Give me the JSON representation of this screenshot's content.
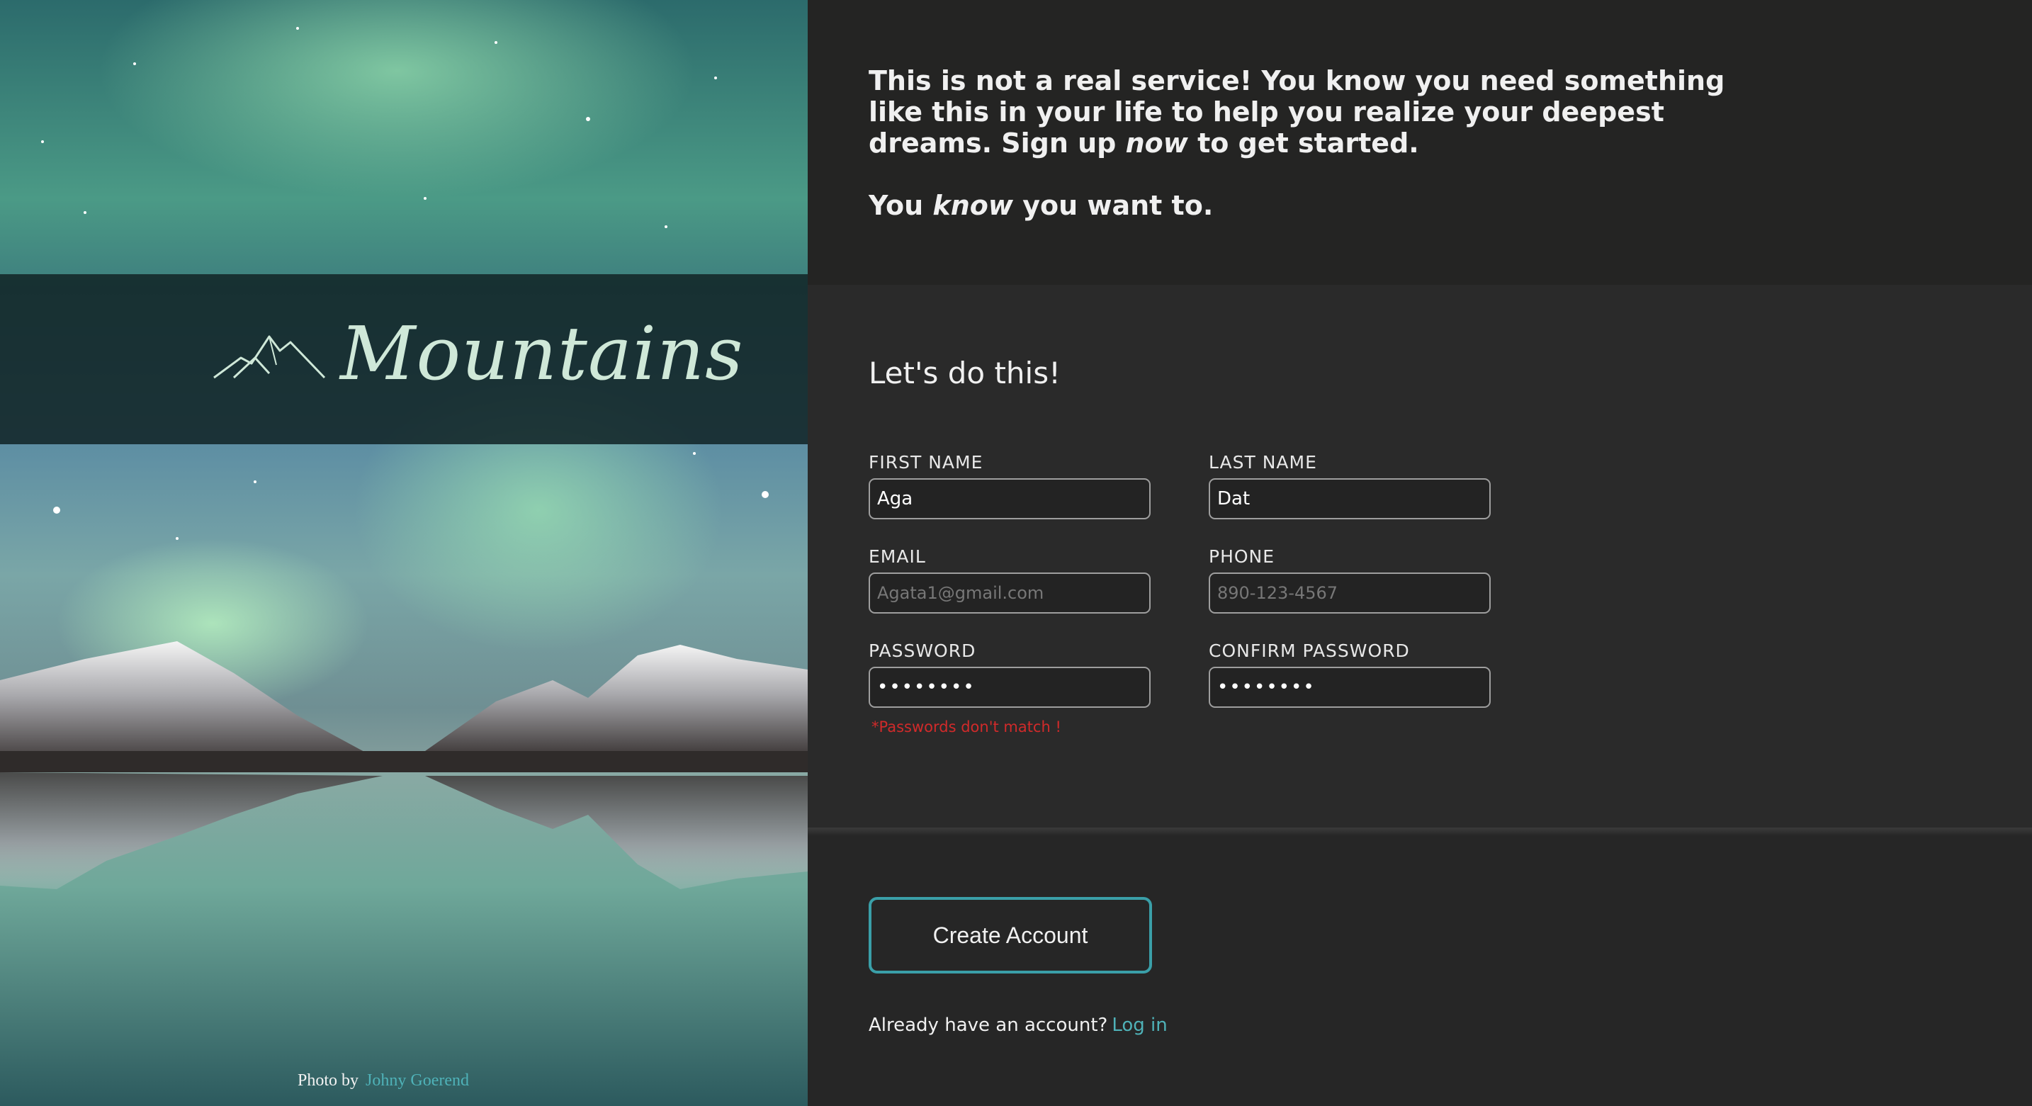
{
  "brand": {
    "name": "Mountains",
    "logo_icon": "mountain-range-icon"
  },
  "photo_credit": {
    "prefix": "Photo by",
    "author": "Johny Goerend"
  },
  "intro": {
    "part1": "This is not a real service! You know you need something like this in your life to help you realize your deepest dreams. Sign up ",
    "emphasis1": "now",
    "part2": " to get started.",
    "line2_a": "You ",
    "emphasis2": "know",
    "line2_b": " you want to."
  },
  "form": {
    "heading": "Let's do this!",
    "first_name": {
      "label": "FIRST NAME",
      "value": "Aga"
    },
    "last_name": {
      "label": "LAST NAME",
      "value": "Dat"
    },
    "email": {
      "label": "EMAIL",
      "placeholder": "Agata1@gmail.com"
    },
    "phone": {
      "label": "PHONE",
      "placeholder": "890-123-4567"
    },
    "password": {
      "label": "PASSWORD",
      "value": "••••••••"
    },
    "confirm_password": {
      "label": "CONFIRM PASSWORD",
      "value": "••••••••"
    },
    "error": "*Passwords don't match !"
  },
  "actions": {
    "create_label": "Create Account",
    "login_prompt": "Already have an account?",
    "login_link": "Log in"
  },
  "colors": {
    "accent": "#3a9fa8",
    "error": "#d12a2a",
    "brand_text": "#cfe8d8",
    "background": "#262626"
  }
}
